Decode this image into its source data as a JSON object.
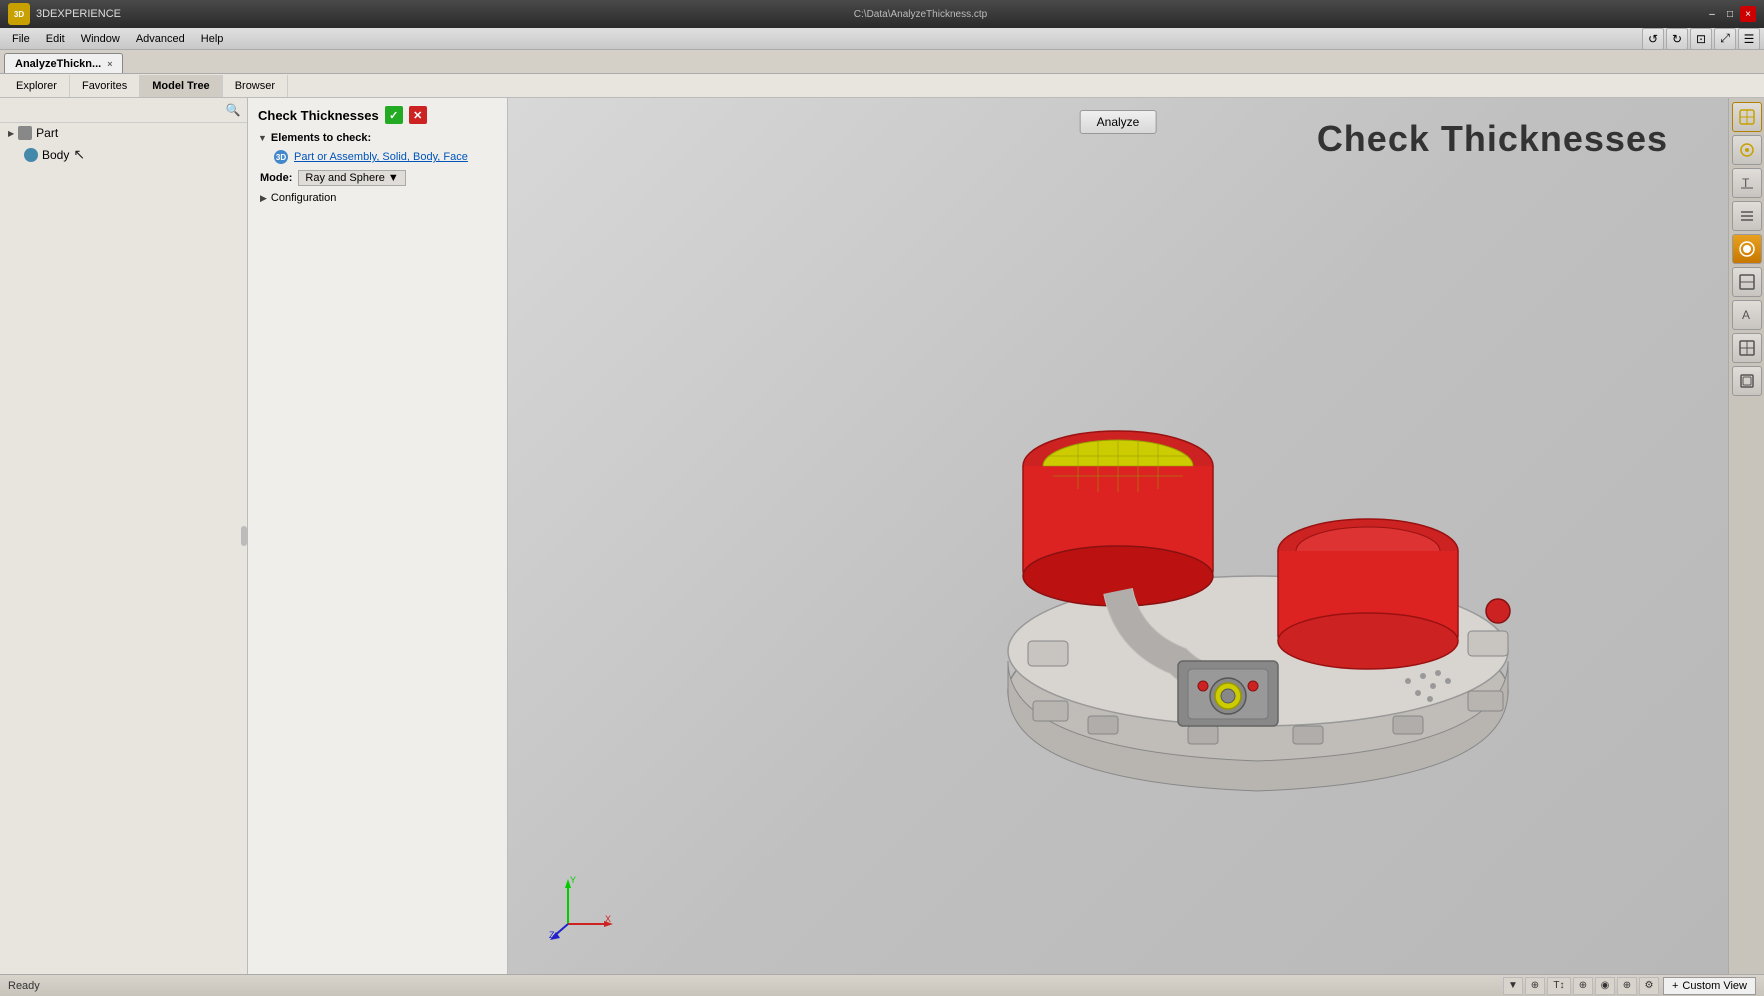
{
  "titlebar": {
    "app_logo": "3D",
    "app_name": "3DEXPERIENCE",
    "tab_name": "AnalyzeThickn...",
    "tab_close": "×",
    "file_path": "C:\\Data\\AnalyzeThickness.ctp",
    "window_minimize": "–",
    "window_maximize": "□",
    "window_close": "×"
  },
  "menubar": {
    "items": [
      "File",
      "Edit",
      "Window",
      "Advanced",
      "Help"
    ],
    "toolbar_icons": [
      "↺",
      "↻",
      "⊡",
      "⤢",
      "☰"
    ]
  },
  "tabs": [
    {
      "label": "AnalyzeThickn...",
      "active": true,
      "close": "×"
    }
  ],
  "nav_tabs": [
    {
      "label": "Explorer",
      "active": false
    },
    {
      "label": "Favorites",
      "active": false
    },
    {
      "label": "Model Tree",
      "active": true
    },
    {
      "label": "Browser",
      "active": false
    }
  ],
  "left_panel": {
    "search_icon": "🔍",
    "tree": [
      {
        "label": "Part",
        "icon": "part"
      },
      {
        "label": "Body",
        "icon": "body"
      }
    ]
  },
  "check_panel": {
    "title": "Check Thicknesses",
    "confirm_icon": "✓",
    "cancel_icon": "✕",
    "elements_section": "Elements to check:",
    "element_link": "Part or Assembly, Solid, Body, Face",
    "mode_label": "Mode:",
    "mode_value": "Ray and Sphere",
    "config_label": "Configuration"
  },
  "viewport": {
    "title": "Check Thicknesses",
    "analyze_btn": "Analyze"
  },
  "right_toolbar": {
    "buttons": [
      {
        "icon": "⊞",
        "type": "normal"
      },
      {
        "icon": "⊙",
        "type": "orange"
      },
      {
        "icon": "T",
        "type": "normal"
      },
      {
        "icon": "≡",
        "type": "normal"
      },
      {
        "icon": "◉",
        "type": "orange-filled"
      },
      {
        "icon": "⊟",
        "type": "normal"
      },
      {
        "icon": "A",
        "type": "normal"
      },
      {
        "icon": "⊠",
        "type": "normal"
      },
      {
        "icon": "⊞",
        "type": "normal"
      }
    ]
  },
  "statusbar": {
    "text": "Ready",
    "custom_view_label": "Custom View",
    "plus_icon": "+",
    "icons": [
      "▼",
      "⊕",
      "T",
      "⊕",
      "◉",
      "⊕",
      "⊙"
    ]
  },
  "colors": {
    "red": "#cc2222",
    "yellow": "#cccc00",
    "orange": "#cc8800",
    "grey_part": "#b0b0b0",
    "dark_red": "#8b0000"
  }
}
